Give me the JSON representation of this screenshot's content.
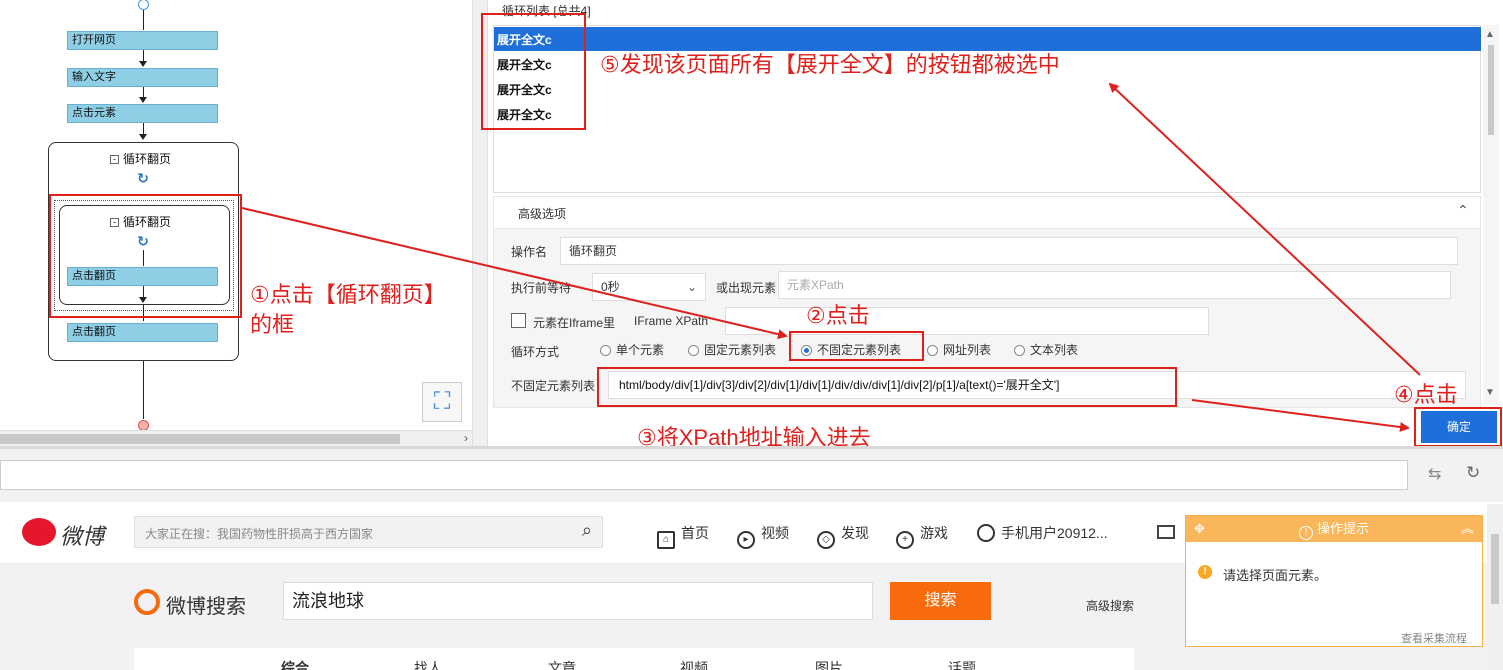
{
  "flow": {
    "nodes": [
      "打开网页",
      "输入文字",
      "点击元素"
    ],
    "outer_loop_title": "循环翻页",
    "inner_loop_title": "循环翻页",
    "inner_node": "点击翻页",
    "after_node": "点击翻页"
  },
  "loop_list": {
    "header": "循环列表 [总共4]",
    "items": [
      "展开全文c",
      "展开全文c",
      "展开全文c",
      "展开全文c"
    ]
  },
  "advanced": {
    "title": "高级选项",
    "op_name_label": "操作名",
    "op_name_value": "循环翻页",
    "wait_label": "执行前等待",
    "wait_value": "0秒",
    "appear_label": "或出现元素",
    "appear_placeholder": "元素XPath",
    "iframe_label": "元素在Iframe里",
    "iframe_xpath_label": "IFrame XPath",
    "loop_mode_label": "循环方式",
    "modes": [
      "单个元素",
      "固定元素列表",
      "不固定元素列表",
      "网址列表",
      "文本列表"
    ],
    "selected_mode": "不固定元素列表",
    "xpath_label": "不固定元素列表",
    "xpath_value": "html/body/div[1]/div[3]/div[2]/div[1]/div[1]/div/div/div[1]/div[2]/p[1]/a[text()='展开全文']",
    "confirm": "确定"
  },
  "annotations": {
    "a1_line1": "①点击【循环翻页】",
    "a1_line2": "的框",
    "a2": "②点击",
    "a3": "③将XPath地址输入进去",
    "a4": "④点击",
    "a5": "⑤发现该页面所有【展开全文】的按钮都被选中"
  },
  "weibo": {
    "logo": "微博",
    "search_placeholder": "大家正在搜：我国药物性肝损高于西方国家",
    "nav": [
      "首页",
      "视频",
      "发现",
      "游戏",
      "手机用户20912..."
    ],
    "search_logo": "微博搜索",
    "search_value": "流浪地球",
    "search_button": "搜索",
    "advanced_search": "高级搜索",
    "tabs": [
      "综合",
      "找人",
      "文章",
      "视频",
      "图片",
      "话题"
    ]
  },
  "popup": {
    "title": "操作提示",
    "message": "请选择页面元素。",
    "link": "查看采集流程"
  },
  "colors": {
    "accent_blue": "#1e6fd9",
    "annotation_red": "#e0201c",
    "weibo_orange": "#f76b0d",
    "popup_orange": "#f9b65a"
  }
}
